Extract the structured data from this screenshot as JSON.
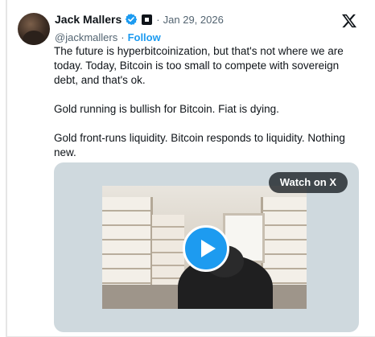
{
  "author": {
    "name": "Jack Mallers",
    "handle": "@jackmallers",
    "date": "Jan 29, 2026",
    "separator": "·",
    "follow_label": "Follow"
  },
  "tweet": {
    "paragraphs": [
      "The future is hyperbitcoinization, but that's not where we are today. Today, Bitcoin is too small to compete with sovereign debt, and that's ok.",
      "Gold running is bullish for Bitcoin. Fiat is dying.",
      "Gold front-runs liquidity. Bitcoin responds to liquidity. Nothing new."
    ]
  },
  "media": {
    "watch_label": "Watch on X"
  },
  "icons": {
    "verified": "verified-badge-icon",
    "affiliation": "affiliation-badge-icon",
    "platform": "x-logo-icon",
    "play": "play-icon"
  },
  "colors": {
    "accent": "#1d9bf0",
    "text": "#0f1419",
    "muted": "#536471",
    "media_bg": "#cfd9de"
  }
}
